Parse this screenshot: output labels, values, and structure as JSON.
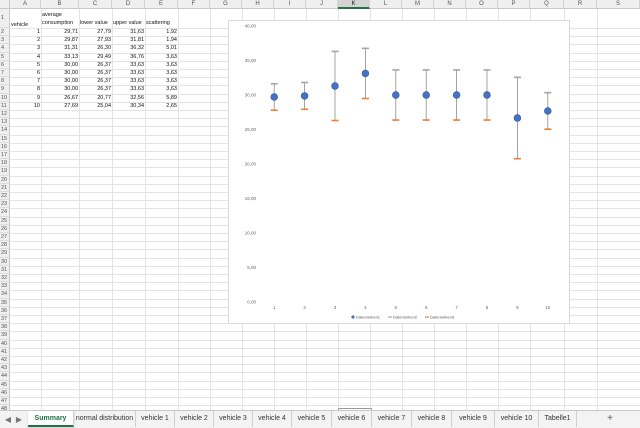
{
  "columns": [
    "A",
    "B",
    "C",
    "D",
    "E",
    "F",
    "G",
    "H",
    "I",
    "J",
    "K",
    "L",
    "M",
    "N",
    "O",
    "P",
    "Q",
    "R",
    "S"
  ],
  "selected_column": "K",
  "row_count": 49,
  "headers": {
    "A": "vehicle",
    "B1": "average",
    "B2": "consumption",
    "C": "lower value",
    "D": "upper value",
    "E": "scattering"
  },
  "rows": [
    {
      "vehicle": "1",
      "average": "29,71",
      "lower": "27,79",
      "upper": "31,63",
      "scatter": "1,92"
    },
    {
      "vehicle": "2",
      "average": "29,87",
      "lower": "27,93",
      "upper": "31,81",
      "scatter": "1,94"
    },
    {
      "vehicle": "3",
      "average": "31,31",
      "lower": "26,30",
      "upper": "36,32",
      "scatter": "5,01"
    },
    {
      "vehicle": "4",
      "average": "33,13",
      "lower": "29,49",
      "upper": "36,76",
      "scatter": "3,63"
    },
    {
      "vehicle": "5",
      "average": "30,00",
      "lower": "26,37",
      "upper": "33,63",
      "scatter": "3,63"
    },
    {
      "vehicle": "6",
      "average": "30,00",
      "lower": "26,37",
      "upper": "33,63",
      "scatter": "3,63"
    },
    {
      "vehicle": "7",
      "average": "30,00",
      "lower": "26,37",
      "upper": "33,63",
      "scatter": "3,63"
    },
    {
      "vehicle": "8",
      "average": "30,00",
      "lower": "26,37",
      "upper": "33,63",
      "scatter": "3,63"
    },
    {
      "vehicle": "9",
      "average": "26,67",
      "lower": "20,77",
      "upper": "32,56",
      "scatter": "5,89"
    },
    {
      "vehicle": "10",
      "average": "27,69",
      "lower": "25,04",
      "upper": "30,34",
      "scatter": "2,65"
    }
  ],
  "chart_data": {
    "type": "scatter",
    "x": [
      1,
      2,
      3,
      4,
      5,
      6,
      7,
      8,
      9,
      10
    ],
    "series": [
      {
        "name": "Datenreihen1",
        "values": [
          29.71,
          29.87,
          31.31,
          33.13,
          30.0,
          30.0,
          30.0,
          30.0,
          26.67,
          27.69
        ],
        "color": "#4472c4",
        "marker": "circle"
      },
      {
        "name": "Datenreihen2",
        "values": [
          31.63,
          31.81,
          36.32,
          36.76,
          33.63,
          33.63,
          33.63,
          33.63,
          32.56,
          30.34
        ],
        "color": "#a5a5a5",
        "marker": "dash"
      },
      {
        "name": "Datenreihen3",
        "values": [
          27.79,
          27.93,
          26.3,
          29.49,
          26.37,
          26.37,
          26.37,
          26.37,
          20.77,
          25.04
        ],
        "color": "#ed7d31",
        "marker": "dash"
      }
    ],
    "error_bars": "lower-to-upper",
    "yticks": [
      "0,00",
      "5,00",
      "10,00",
      "15,00",
      "20,00",
      "25,00",
      "30,00",
      "35,00",
      "40,00"
    ],
    "ylim": [
      0,
      40
    ],
    "xticks": [
      "1",
      "2",
      "3",
      "4",
      "5",
      "6",
      "7",
      "8",
      "9",
      "10"
    ],
    "grid": false,
    "legend_position": "bottom"
  },
  "sheet_tabs": [
    "Summary",
    "normal distribution",
    "vehicle 1",
    "vehicle 2",
    "vehicle 3",
    "vehicle 4",
    "vehicle 5",
    "vehicle 6",
    "vehicle 7",
    "vehicle 8",
    "vehicle 9",
    "vehicle 10",
    "Tabelle1"
  ],
  "active_tab": "Summary",
  "nav": {
    "prev": "◀",
    "next": "▶",
    "add": "+"
  }
}
